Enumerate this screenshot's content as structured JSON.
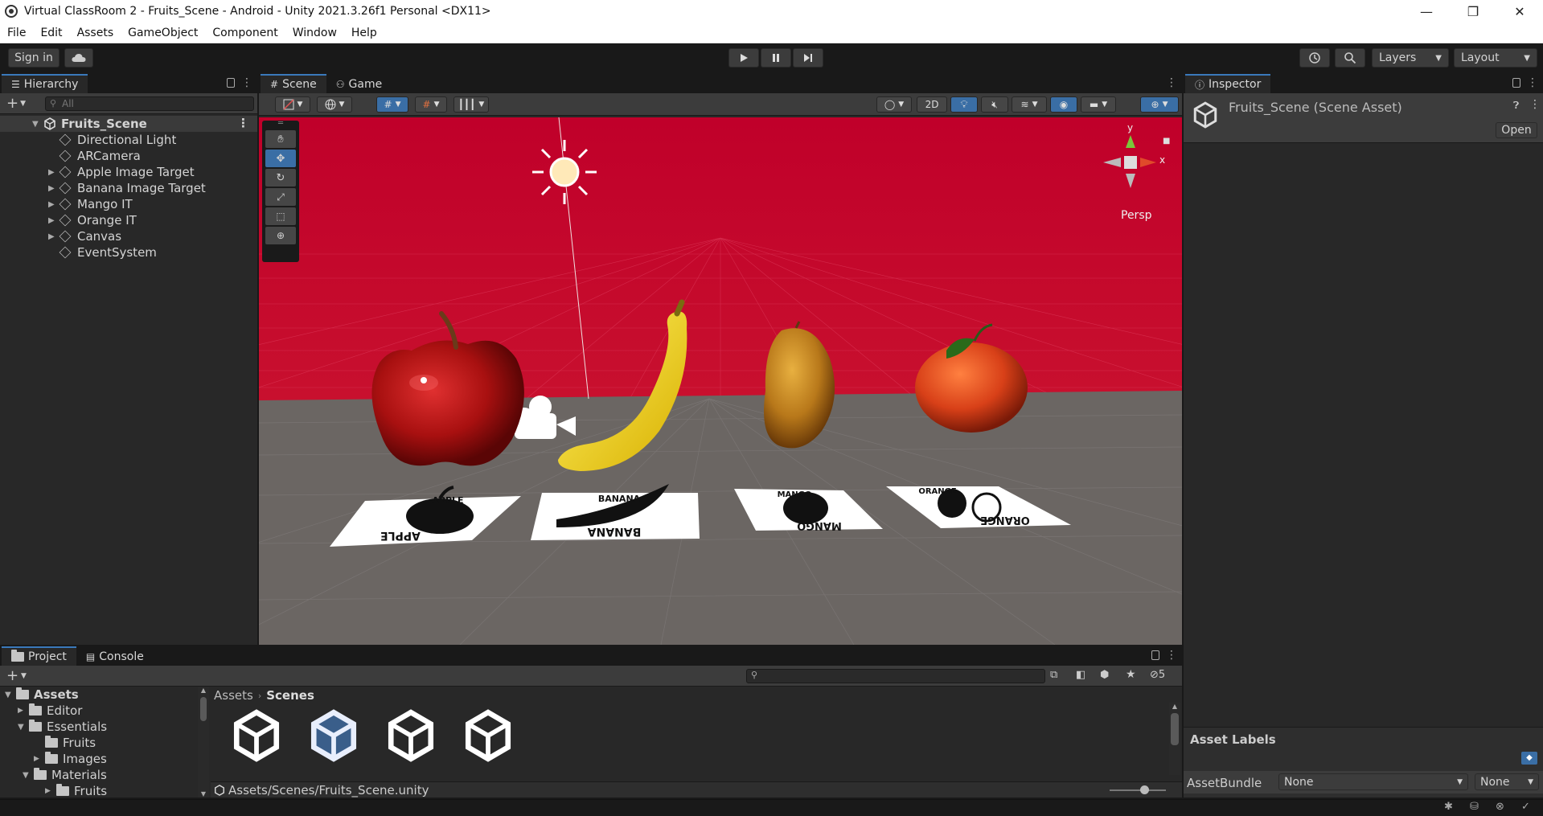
{
  "window": {
    "title": "Virtual ClassRoom 2 - Fruits_Scene - Android - Unity 2021.3.26f1 Personal <DX11>",
    "minimize": "—",
    "restore": "❐",
    "close": "✕"
  },
  "menu": [
    "File",
    "Edit",
    "Assets",
    "GameObject",
    "Component",
    "Window",
    "Help"
  ],
  "toolbar": {
    "sign_in": "Sign in",
    "layers": "Layers",
    "layout": "Layout"
  },
  "hierarchy": {
    "tab": "Hierarchy",
    "search_placeholder": "All",
    "scene": "Fruits_Scene",
    "items": [
      {
        "label": "Directional Light",
        "expandable": false
      },
      {
        "label": "ARCamera",
        "expandable": false
      },
      {
        "label": "Apple Image Target",
        "expandable": true
      },
      {
        "label": "Banana Image Target",
        "expandable": true
      },
      {
        "label": "Mango IT",
        "expandable": true
      },
      {
        "label": "Orange IT",
        "expandable": true
      },
      {
        "label": "Canvas",
        "expandable": true
      },
      {
        "label": "EventSystem",
        "expandable": false
      }
    ]
  },
  "scene": {
    "tabs": [
      "Scene",
      "Game"
    ],
    "btn_2d": "2D",
    "gizmo_y": "y",
    "gizmo_x": "x",
    "persp": "Persp",
    "cards": [
      {
        "top": "APPLE",
        "bottom": "APPLE"
      },
      {
        "top": "BANANA",
        "bottom": "BANANA"
      },
      {
        "top": "MANGO",
        "bottom": "MANGO"
      },
      {
        "top": "ORANGE",
        "bottom": "ORANGE"
      }
    ]
  },
  "inspector": {
    "tab": "Inspector",
    "title": "Fruits_Scene (Scene Asset)",
    "open_btn": "Open",
    "asset_labels": "Asset Labels",
    "asset_bundle_label": "AssetBundle",
    "bundle_value": "None",
    "variant_value": "None"
  },
  "project": {
    "tabs": [
      "Project",
      "Console"
    ],
    "hidden_count": "5",
    "breadcrumb": [
      "Assets",
      "Scenes"
    ],
    "path": "Assets/Scenes/Fruits_Scene.unity",
    "tree": [
      {
        "label": "Assets",
        "depth": 0,
        "arrow": "▼",
        "bold": true
      },
      {
        "label": "Editor",
        "depth": 1,
        "arrow": "▶",
        "bold": false
      },
      {
        "label": "Essentials",
        "depth": 1,
        "arrow": "▼",
        "bold": false
      },
      {
        "label": "Fruits",
        "depth": 2,
        "arrow": "",
        "bold": false
      },
      {
        "label": "Images",
        "depth": 2,
        "arrow": "▶",
        "bold": false
      },
      {
        "label": "Materials",
        "depth": 1,
        "arrow": "▼",
        "bold": false
      },
      {
        "label": "Fruits",
        "depth": 2,
        "arrow": "▶",
        "bold": false
      }
    ]
  },
  "colors": {
    "accent": "#3a79bb",
    "sky": "#c00024",
    "ground": "#6b6663"
  }
}
